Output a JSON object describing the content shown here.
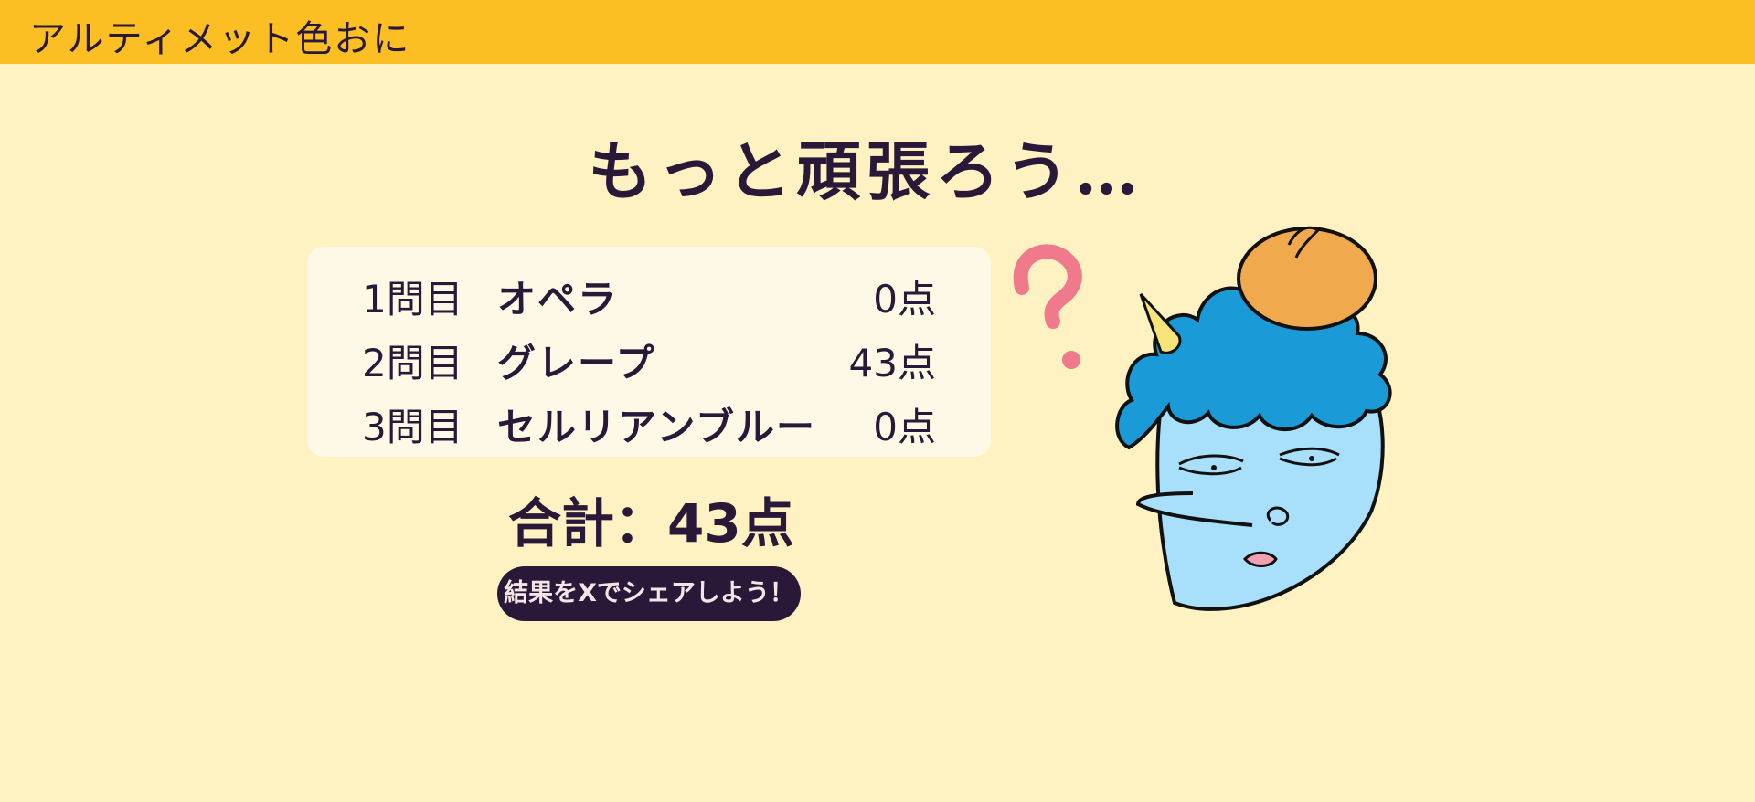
{
  "header": {
    "app_title": "アルティメット色おに",
    "background_color": "#fbbf24"
  },
  "result": {
    "title": "もっと頑張ろう…",
    "rows": [
      {
        "number": "1問目",
        "color_name": "オペラ",
        "score": "0点"
      },
      {
        "number": "2問目",
        "color_name": "グレープ",
        "score": "43点"
      },
      {
        "number": "3問目",
        "color_name": "セルリアンブルー",
        "score": "0点"
      }
    ],
    "total": "合計：43点",
    "share_label": "結果をXでシェアしよう！"
  },
  "illustration": {
    "icons": [
      "question-mark-icon",
      "confused-oni-character"
    ],
    "colors": {
      "page_background": "#fef2c2",
      "card_background": "#fef9e6",
      "text": "#2a1838",
      "oni_hair": "#1a9ad6",
      "oni_face": "#a8e0fb",
      "beret": "#f0a94c",
      "question_mark": "#f07a8c",
      "horn": "#f7e57a"
    }
  }
}
